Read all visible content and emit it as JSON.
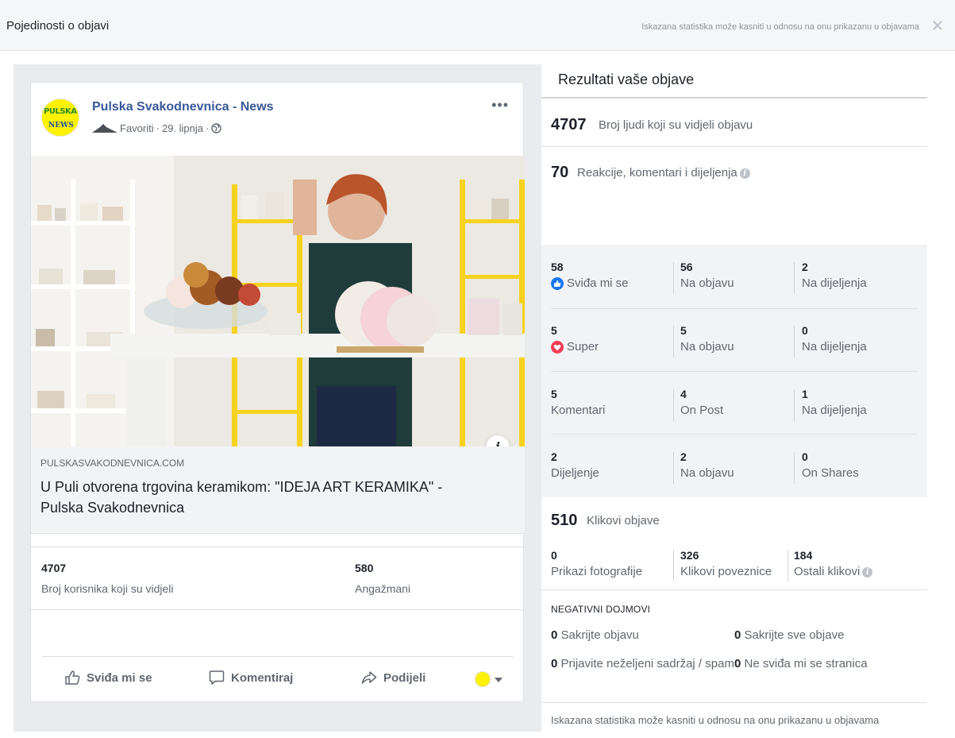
{
  "header": {
    "title": "Pojedinosti o objavi",
    "note": "Iskazana statistika može kasniti u odnosu na onu prikazanu u objavama"
  },
  "post": {
    "page_name": "Pulska Svakodnevnica - News",
    "avatar_text_1": "PULSKA",
    "avatar_text_2": "NEWS",
    "audience": "Favoriti",
    "date": "29. lipnja",
    "link_domain": "PULSKASVAKODNEVNICA.COM",
    "link_title": "U Puli otvorena trgovina keramikom: \"IDEJA ART KERAMIKA\" - Pulska Svakodnevnica",
    "stats": {
      "reach_value": "4707",
      "reach_label": "Broj korisnika koji su vidjeli",
      "engagement_value": "580",
      "engagement_label": "Angažmani"
    },
    "actions": {
      "like": "Sviđa mi se",
      "comment": "Komentiraj",
      "share": "Podijeli"
    }
  },
  "results": {
    "title": "Rezultati vaše objave",
    "reach": {
      "value": "4707",
      "label": "Broj ljudi koji su vidjeli objavu"
    },
    "engagement": {
      "value": "70",
      "label": "Reakcije, komentari i dijeljenja"
    },
    "rows": [
      {
        "total": "58",
        "label": "Sviđa mi se",
        "icon": "like-icon",
        "on_post": "56",
        "on_post_label": "Na objavu",
        "on_shares": "2",
        "on_shares_label": "Na dijeljenja"
      },
      {
        "total": "5",
        "label": "Super",
        "icon": "love-icon",
        "on_post": "5",
        "on_post_label": "Na objavu",
        "on_shares": "0",
        "on_shares_label": "Na dijeljenja"
      },
      {
        "total": "5",
        "label": "Komentari",
        "icon": "",
        "on_post": "4",
        "on_post_label": "On Post",
        "on_shares": "1",
        "on_shares_label": "Na dijeljenja"
      },
      {
        "total": "2",
        "label": "Dijeljenje",
        "icon": "",
        "on_post": "2",
        "on_post_label": "Na objavu",
        "on_shares": "0",
        "on_shares_label": "On Shares"
      }
    ],
    "clicks": {
      "value": "510",
      "label": "Klikovi objave",
      "photo_views": "0",
      "photo_views_label": "Prikazi fotografije",
      "link_clicks": "326",
      "link_clicks_label": "Klikovi poveznice",
      "other_clicks": "184",
      "other_clicks_label": "Ostali klikovi"
    },
    "negative": {
      "heading": "NEGATIVNI DOJMOVI",
      "hide_post_value": "0",
      "hide_post_label": "Sakrijte objavu",
      "hide_all_value": "0",
      "hide_all_label": "Sakrijte sve objave",
      "report_value": "0",
      "report_label": "Prijavite neželjeni sadržaj / spam",
      "unlike_value": "0",
      "unlike_label": "Ne sviđa mi se stranica"
    },
    "footer_note": "Iskazana statistika može kasniti u odnosu na onu prikazanu u objavama"
  },
  "colors": {
    "link_blue": "#385898",
    "like_blue": "#1877f2",
    "love_red": "#f33e58",
    "shelf_yellow": "#f7d21e"
  }
}
